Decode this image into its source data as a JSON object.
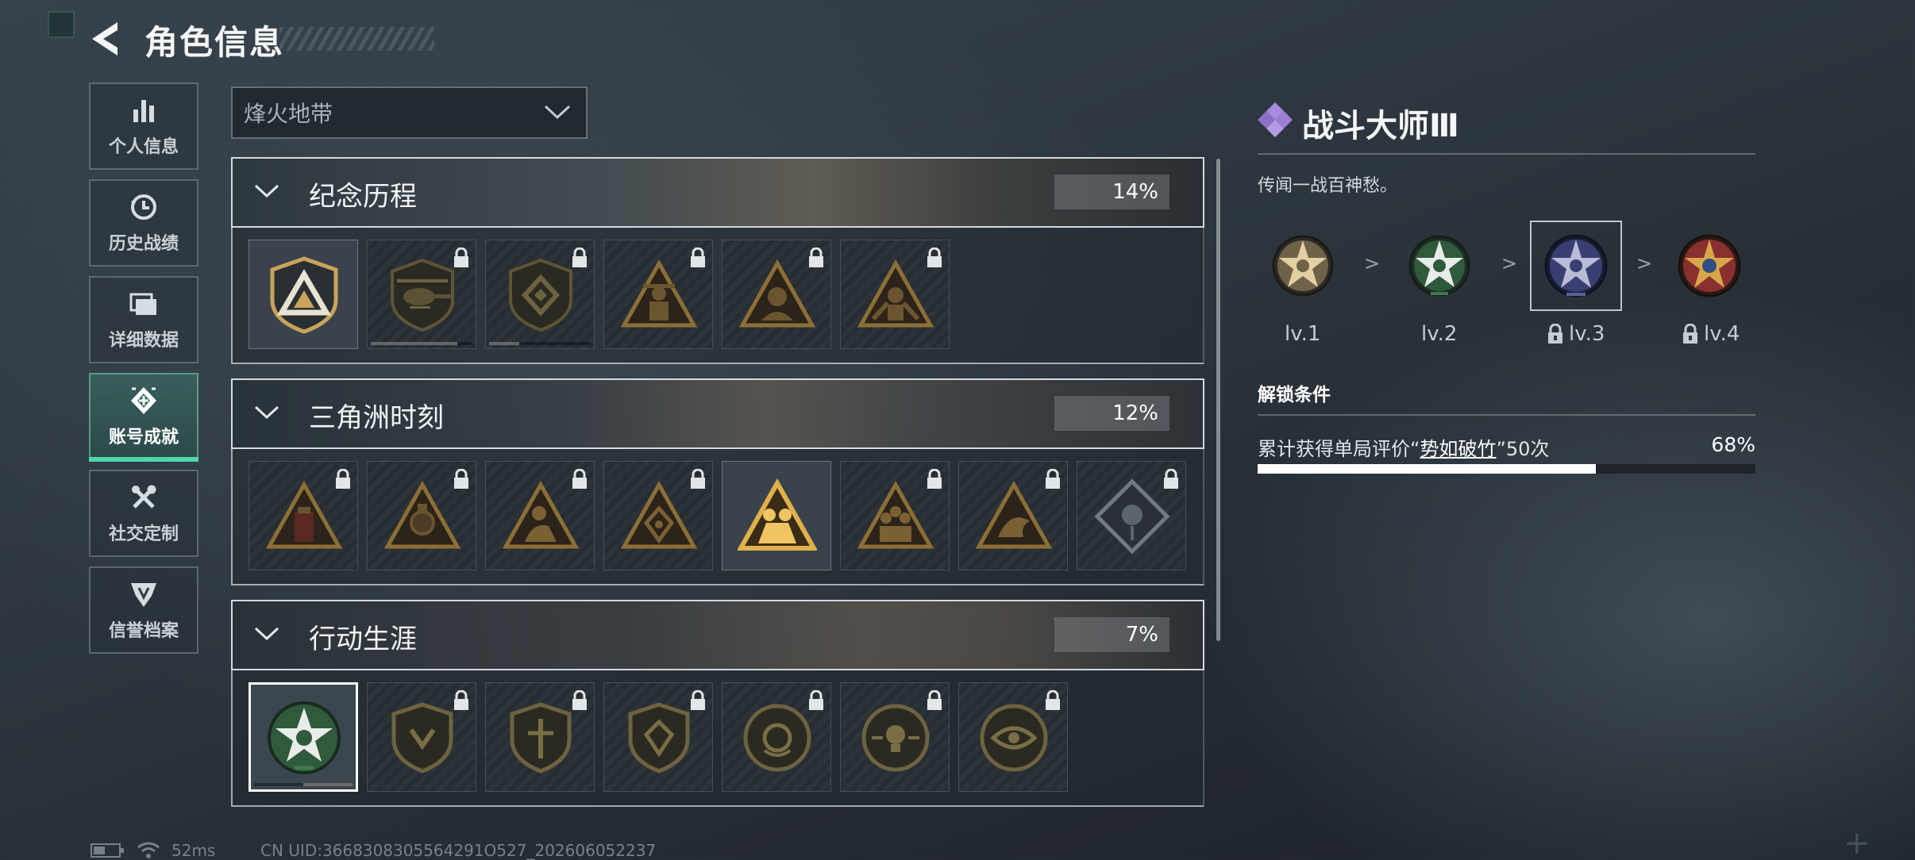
{
  "header": {
    "title": "角色信息"
  },
  "sidebar": {
    "items": [
      {
        "label": "个人信息",
        "icon": "bar-chart-icon",
        "active": false
      },
      {
        "label": "历史战绩",
        "icon": "history-clock-icon",
        "active": false
      },
      {
        "label": "详细数据",
        "icon": "cards-icon",
        "active": false
      },
      {
        "label": "账号成就",
        "icon": "achievement-icon",
        "active": true
      },
      {
        "label": "社交定制",
        "icon": "tools-icon",
        "active": false
      },
      {
        "label": "信誉档案",
        "icon": "shield-icon",
        "active": false
      }
    ]
  },
  "dropdown": {
    "selected": "烽火地带"
  },
  "sections": [
    {
      "name": "纪念历程",
      "percent": "14%",
      "badges": [
        {
          "icon": "triangle-shield-badge-icon",
          "locked": false,
          "progress": 0
        },
        {
          "icon": "helicopter-badge-icon",
          "locked": true,
          "progress": 0.85
        },
        {
          "icon": "crest-badge-icon",
          "locked": true,
          "progress": 0.3
        },
        {
          "icon": "soldier-triangle-badge-icon",
          "locked": true,
          "progress": 0
        },
        {
          "icon": "character-triangle-badge-icon",
          "locked": true,
          "progress": 0
        },
        {
          "icon": "warrior-triangle-badge-icon",
          "locked": true,
          "progress": 0
        }
      ]
    },
    {
      "name": "三角洲时刻",
      "percent": "12%",
      "badges": [
        {
          "icon": "robot-triangle-badge-icon",
          "locked": true,
          "progress": 0
        },
        {
          "icon": "mech-triangle-badge-icon",
          "locked": true,
          "progress": 0
        },
        {
          "icon": "figure-triangle-badge-icon",
          "locked": true,
          "progress": 0
        },
        {
          "icon": "emblem-triangle-badge-icon",
          "locked": true,
          "progress": 0
        },
        {
          "icon": "squad-triangle-badge-icon",
          "locked": false,
          "progress": 0
        },
        {
          "icon": "team-triangle-badge-icon",
          "locked": true,
          "progress": 0
        },
        {
          "icon": "beast-triangle-badge-icon",
          "locked": true,
          "progress": 0
        },
        {
          "icon": "rose-diamond-badge-icon",
          "locked": true,
          "progress": 0
        }
      ]
    },
    {
      "name": "行动生涯",
      "percent": "7%",
      "badges": [
        {
          "icon": "star-skull-badge-icon",
          "locked": false,
          "selected": true,
          "progress": 0.5
        },
        {
          "icon": "shield-emblem-badge-icon",
          "locked": true,
          "progress": 0
        },
        {
          "icon": "shield-sword-badge-icon",
          "locked": true,
          "progress": 0
        },
        {
          "icon": "shield-gem-badge-icon",
          "locked": true,
          "progress": 0
        },
        {
          "icon": "ring-orb-badge-icon",
          "locked": true,
          "progress": 0
        },
        {
          "icon": "ring-skull-badge-icon",
          "locked": true,
          "progress": 0
        },
        {
          "icon": "ring-eye-badge-icon",
          "locked": true,
          "progress": 0
        }
      ]
    }
  ],
  "detail": {
    "title": "战斗大师Ⅲ",
    "description": "传闻一战百神愁。",
    "levels": [
      {
        "label": "lv.1",
        "locked": false,
        "color": "#c8b48a"
      },
      {
        "label": "lv.2",
        "locked": false,
        "color": "#3f7a4e"
      },
      {
        "label": "lv.3",
        "locked": true,
        "current": true,
        "color": "#3a3f73"
      },
      {
        "label": "lv.4",
        "locked": true,
        "color": "#8a2f2f"
      }
    ],
    "arrow": ">",
    "unlock_heading": "解锁条件",
    "condition_prefix": "累计获得单局评价“",
    "condition_highlight": "势如破竹",
    "condition_suffix": "”50次",
    "condition_percent": "68%",
    "condition_progress": 0.68
  },
  "status": {
    "ping": "52ms",
    "uid": "CN UID:3668308305564291O527_202606052237"
  },
  "colors": {
    "accent": "#4dd7a6",
    "badge_gold": "#c9a35a",
    "badge_dark": "#5a4a2c"
  }
}
